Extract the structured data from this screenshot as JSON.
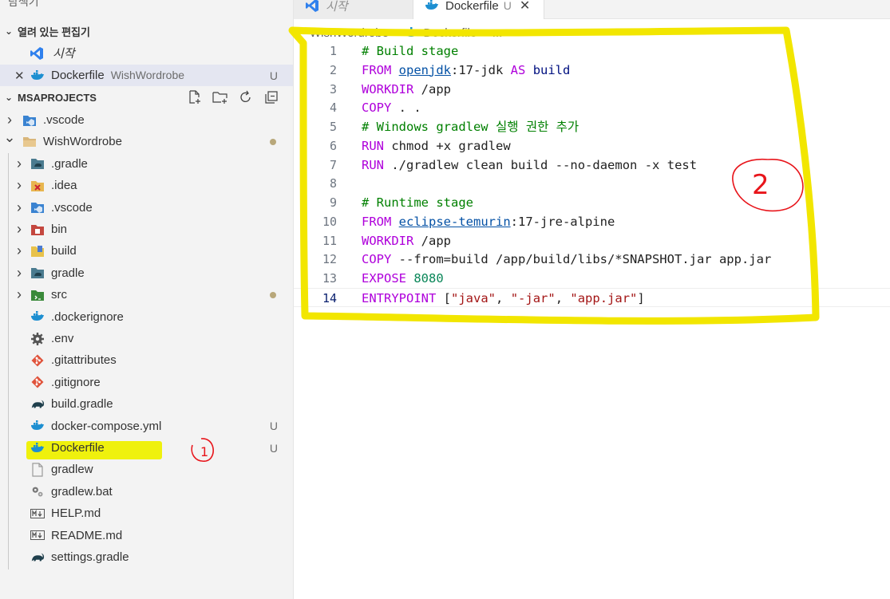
{
  "sidebar": {
    "title": "탐색기",
    "more_label": "···",
    "open_editors": {
      "heading": "열려 있는 편집기",
      "items": [
        {
          "label": "시작",
          "icon": "vscode-icon"
        },
        {
          "label": "Dockerfile",
          "description": "WishWordrobe",
          "status": "U",
          "icon": "docker-icon"
        }
      ]
    },
    "project": {
      "heading": "MSAPROJECTS",
      "items": [
        {
          "label": ".vscode",
          "icon": "vscode-folder-icon",
          "type": "folder"
        },
        {
          "label": "WishWordrobe",
          "icon": "folder-icon",
          "type": "folder-open"
        },
        {
          "label": ".gradle",
          "icon": "gradle-folder-icon",
          "type": "folder"
        },
        {
          "label": ".idea",
          "icon": "idea-folder-icon",
          "type": "folder"
        },
        {
          "label": ".vscode",
          "icon": "vscode-folder-icon",
          "type": "folder"
        },
        {
          "label": "bin",
          "icon": "bin-folder-icon",
          "type": "folder"
        },
        {
          "label": "build",
          "icon": "build-folder-icon",
          "type": "folder"
        },
        {
          "label": "gradle",
          "icon": "gradle-folder-icon",
          "type": "folder"
        },
        {
          "label": "src",
          "icon": "src-folder-icon",
          "type": "folder"
        },
        {
          "label": ".dockerignore",
          "icon": "docker-icon",
          "type": "file"
        },
        {
          "label": ".env",
          "icon": "gear-icon",
          "type": "file"
        },
        {
          "label": ".gitattributes",
          "icon": "git-icon",
          "type": "file"
        },
        {
          "label": ".gitignore",
          "icon": "git-icon",
          "type": "file"
        },
        {
          "label": "build.gradle",
          "icon": "gradle-icon",
          "type": "file"
        },
        {
          "label": "docker-compose.yml",
          "icon": "docker-icon",
          "type": "file",
          "status": "U"
        },
        {
          "label": "Dockerfile",
          "icon": "docker-icon",
          "type": "file",
          "status": "U"
        },
        {
          "label": "gradlew",
          "icon": "file-icon",
          "type": "file"
        },
        {
          "label": "gradlew.bat",
          "icon": "gears-icon",
          "type": "file"
        },
        {
          "label": "HELP.md",
          "icon": "markdown-icon",
          "type": "file"
        },
        {
          "label": "README.md",
          "icon": "markdown-icon",
          "type": "file"
        },
        {
          "label": "settings.gradle",
          "icon": "gradle-icon",
          "type": "file"
        }
      ]
    }
  },
  "tabs": [
    {
      "label": "시작",
      "active": false
    },
    {
      "label": "Dockerfile",
      "status": "U",
      "active": true
    }
  ],
  "breadcrumb": [
    "WishWordrobe",
    "Dockerfile",
    "..."
  ],
  "editor": {
    "lines": [
      {
        "n": "1",
        "text": "# Build stage"
      },
      {
        "n": "2",
        "text": "FROM openjdk:17-jdk AS build"
      },
      {
        "n": "3",
        "text": "WORKDIR /app"
      },
      {
        "n": "4",
        "text": "COPY . ."
      },
      {
        "n": "5",
        "text": "# Windows gradlew 실행 권한 추가"
      },
      {
        "n": "6",
        "text": "RUN chmod +x gradlew"
      },
      {
        "n": "7",
        "text": "RUN ./gradlew clean build --no-daemon -x test"
      },
      {
        "n": "8",
        "text": ""
      },
      {
        "n": "9",
        "text": "# Runtime stage"
      },
      {
        "n": "10",
        "text": "FROM eclipse-temurin:17-jre-alpine"
      },
      {
        "n": "11",
        "text": "WORKDIR /app"
      },
      {
        "n": "12",
        "text": "COPY --from=build /app/build/libs/*SNAPSHOT.jar app.jar"
      },
      {
        "n": "13",
        "text": "EXPOSE 8080"
      },
      {
        "n": "14",
        "text": "ENTRYPOINT [\"java\", \"-jar\", \"app.jar\"]"
      }
    ]
  },
  "annotations": {
    "one": "1",
    "two": "2"
  },
  "colors": {
    "highlight": "#eef000",
    "annotation_red": "#e8151b",
    "keyword": "#af00db",
    "comment": "#008000",
    "string": "#a31515"
  }
}
